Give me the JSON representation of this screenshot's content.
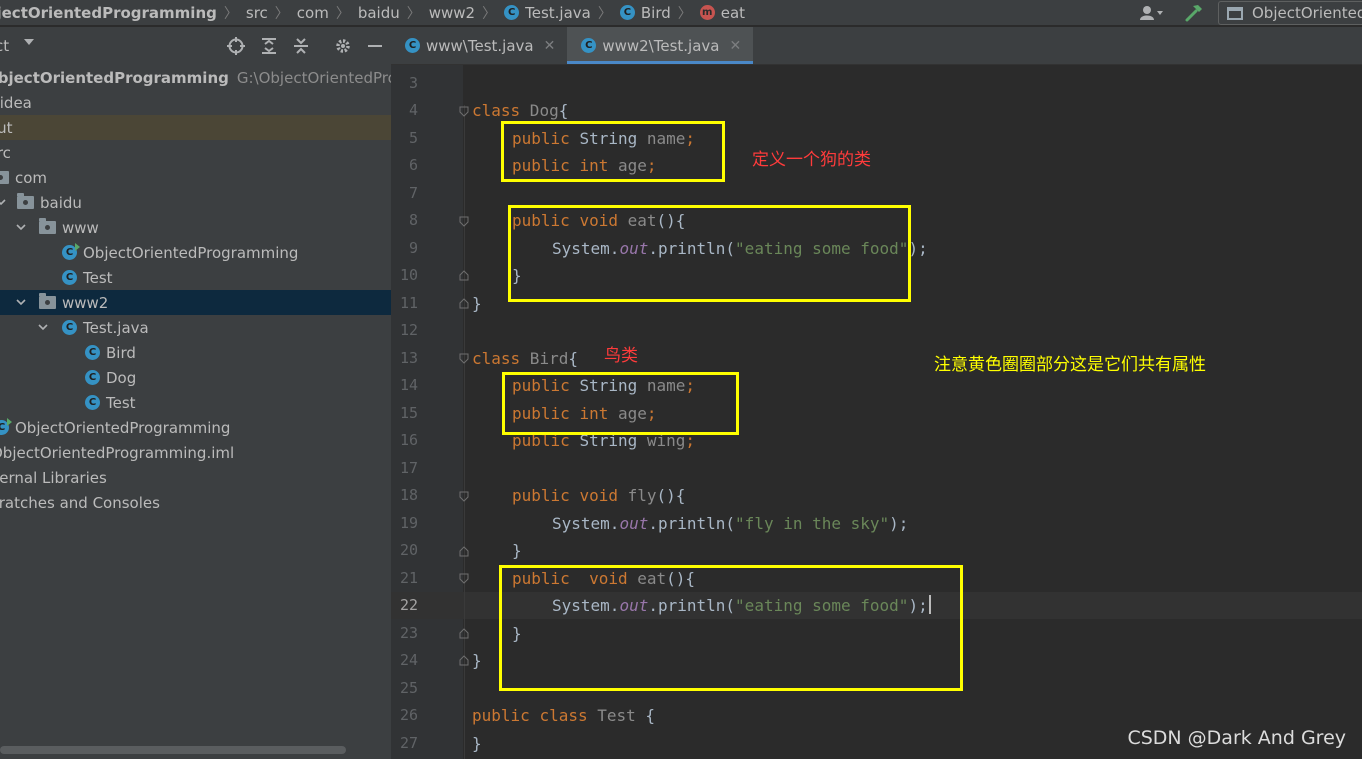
{
  "navbar": {
    "project": "ObjectOrientedProgramming",
    "crumbs": [
      "src",
      "com",
      "baidu",
      "www2"
    ],
    "file": "Test.java",
    "class": "Bird",
    "method": "eat",
    "run_config": "ObjectOrientedProgramming",
    "icons": [
      "user-icon",
      "build-hammer-icon",
      "window-icon"
    ]
  },
  "project_panel": {
    "title": "Project",
    "root": {
      "name": "ObjectOrientedProgramming",
      "path": "G:\\ObjectOrientedProgramming"
    },
    "items": [
      ".idea",
      "out",
      "src",
      "com",
      "baidu",
      "www",
      "ObjectOrientedProgramming",
      "Test",
      "www2",
      "Test.java",
      "Bird",
      "Dog",
      "Test",
      "ObjectOrientedProgramming",
      "ObjectOrientedProgramming.iml",
      "External Libraries",
      "Scratches and Consoles"
    ]
  },
  "tabs": [
    {
      "label": "www\\Test.java",
      "active": false
    },
    {
      "label": "www2\\Test.java",
      "active": true
    }
  ],
  "editor": {
    "current_line": 22,
    "lines": [
      {
        "n": "3"
      },
      {
        "n": "4"
      },
      {
        "n": "5"
      },
      {
        "n": "6"
      },
      {
        "n": "7"
      },
      {
        "n": "8"
      },
      {
        "n": "9"
      },
      {
        "n": "10"
      },
      {
        "n": "11"
      },
      {
        "n": "12"
      },
      {
        "n": "13"
      },
      {
        "n": "14"
      },
      {
        "n": "15"
      },
      {
        "n": "16"
      },
      {
        "n": "17"
      },
      {
        "n": "18"
      },
      {
        "n": "19"
      },
      {
        "n": "20"
      },
      {
        "n": "21"
      },
      {
        "n": "22"
      },
      {
        "n": "23"
      },
      {
        "n": "24"
      },
      {
        "n": "25"
      },
      {
        "n": "26"
      },
      {
        "n": "27"
      }
    ],
    "code": {
      "l4": [
        "class",
        " Dog",
        "{"
      ],
      "l5": [
        "public",
        " ",
        "String",
        " ",
        "name",
        ";"
      ],
      "l6": [
        "public",
        " ",
        "int",
        " ",
        "age",
        ";"
      ],
      "l8": [
        "public",
        " ",
        "void",
        " ",
        "eat",
        "(){"
      ],
      "l9": [
        "System.",
        "out",
        ".println(",
        "\"eating some food\"",
        ");"
      ],
      "l10": "}",
      "l11": "}",
      "l13": [
        "class",
        " Bird",
        "{"
      ],
      "l14": [
        "public",
        " ",
        "String",
        " ",
        "name",
        ";"
      ],
      "l15": [
        "public",
        " ",
        "int",
        " ",
        "age",
        ";"
      ],
      "l16": [
        "public",
        " ",
        "String",
        " ",
        "wing",
        ";"
      ],
      "l18": [
        "public",
        " ",
        "void",
        " ",
        "fly",
        "(){"
      ],
      "l19": [
        "System.",
        "out",
        ".println(",
        "\"fly in the sky\"",
        ");"
      ],
      "l20": "}",
      "l21": [
        "public",
        "  ",
        "void",
        " ",
        "eat",
        "(){"
      ],
      "l22": [
        "System.",
        "out",
        ".println(",
        "\"eating some food\"",
        ");"
      ],
      "l23": "}",
      "l24": "}",
      "l26": [
        "public",
        " ",
        "class",
        " Test",
        " {"
      ],
      "l27": "}"
    }
  },
  "annotations": {
    "dog_note": "定义一个狗的类",
    "bird_note": "鸟类",
    "common_note": "注意黄色圈圈部分这是它们共有属性",
    "box_color": "#ffff00",
    "red_note_color": "#ff3b3b",
    "yellow_note_color": "#ffff00"
  },
  "watermark": "CSDN @Dark And Grey"
}
